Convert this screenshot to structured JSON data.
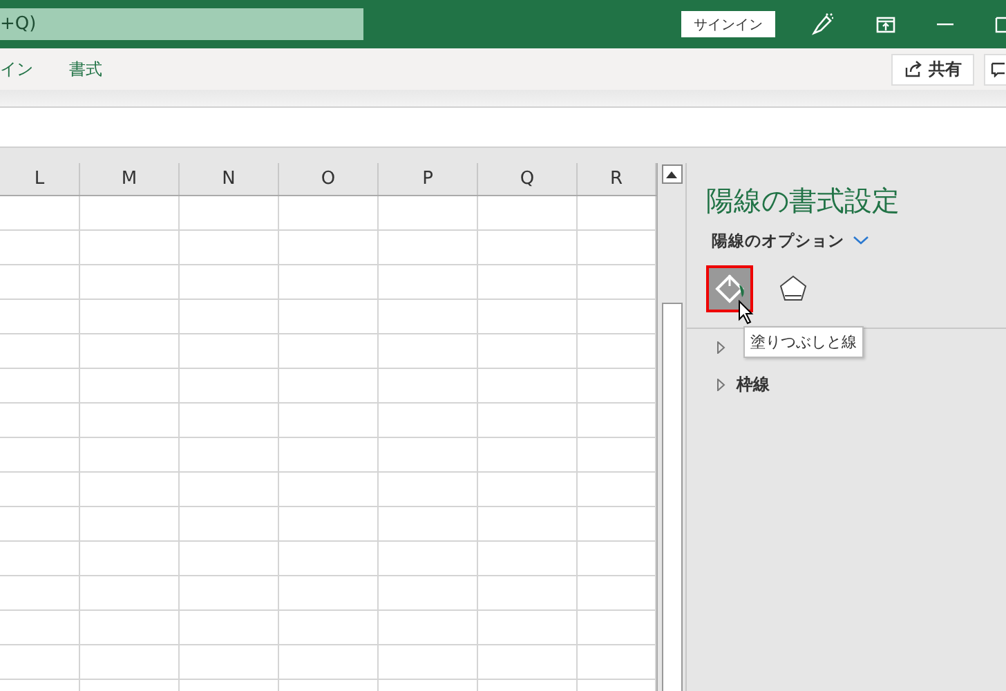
{
  "title_bar": {
    "search_text": "+Q)",
    "signin": "サインイン"
  },
  "ribbon": {
    "tab": "イン",
    "tabs": [
      {
        "label": "書式",
        "selected": false
      }
    ],
    "share": "共有"
  },
  "sheet": {
    "columns": [
      "L",
      "M",
      "N",
      "O",
      "P",
      "Q",
      "R"
    ]
  },
  "pane": {
    "title": "陽線の書式設定",
    "options": "陽線のオプション",
    "icon_tabs": [
      {
        "kind": "fill",
        "selected": true
      },
      {
        "kind": "shape",
        "selected": false
      }
    ],
    "tooltip": "塗りつぶしと線",
    "sections": [
      {
        "expanded": false
      },
      {
        "label": "枠線",
        "expanded": false
      }
    ]
  }
}
